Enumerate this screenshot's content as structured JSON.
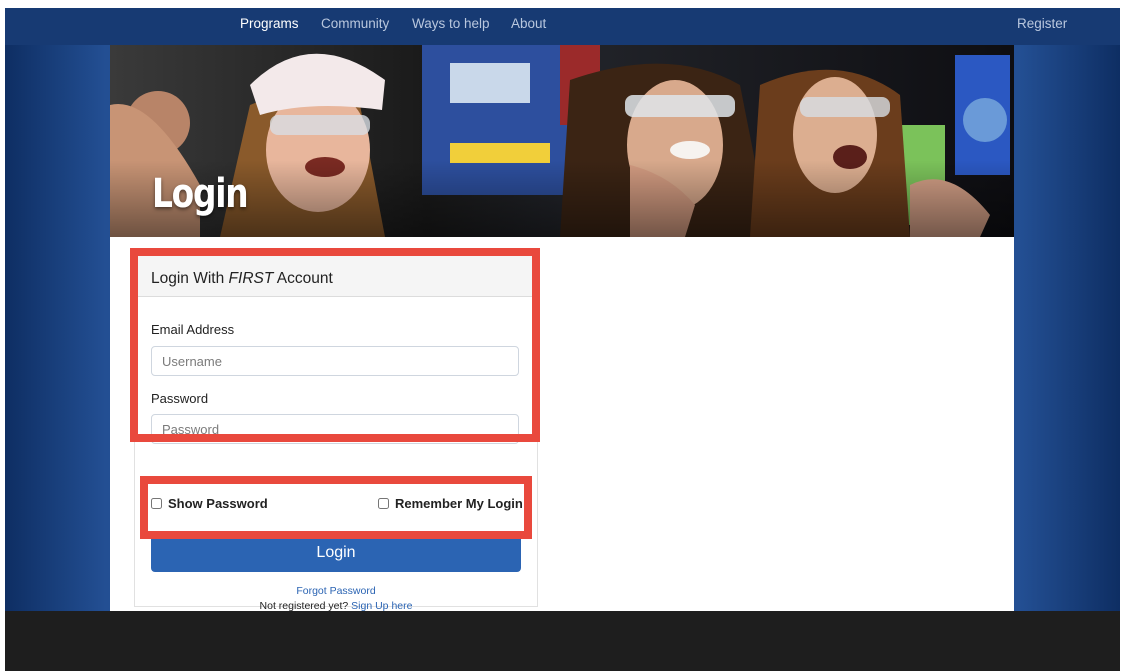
{
  "nav": {
    "items": [
      {
        "label": "Programs",
        "active": true
      },
      {
        "label": "Community",
        "active": false
      },
      {
        "label": "Ways to help",
        "active": false
      },
      {
        "label": "About",
        "active": false
      }
    ],
    "register": "Register"
  },
  "hero": {
    "title": "Login"
  },
  "login": {
    "title_prefix": "Login With ",
    "title_em": "FIRST",
    "title_suffix": " Account",
    "email_label": "Email Address",
    "email_placeholder": "Username",
    "password_label": "Password",
    "password_placeholder": "Password",
    "show_password": "Show Password",
    "remember_login": "Remember My Login",
    "button": "Login",
    "forgot_password": "Forgot Password",
    "not_registered": "Not registered yet?",
    "signup": "Sign Up here"
  },
  "colors": {
    "brand_blue": "#234f93",
    "nav_bar": "#173a73",
    "button": "#2b64b3",
    "highlight": "#e9493d",
    "footer": "#1e1e1e"
  }
}
